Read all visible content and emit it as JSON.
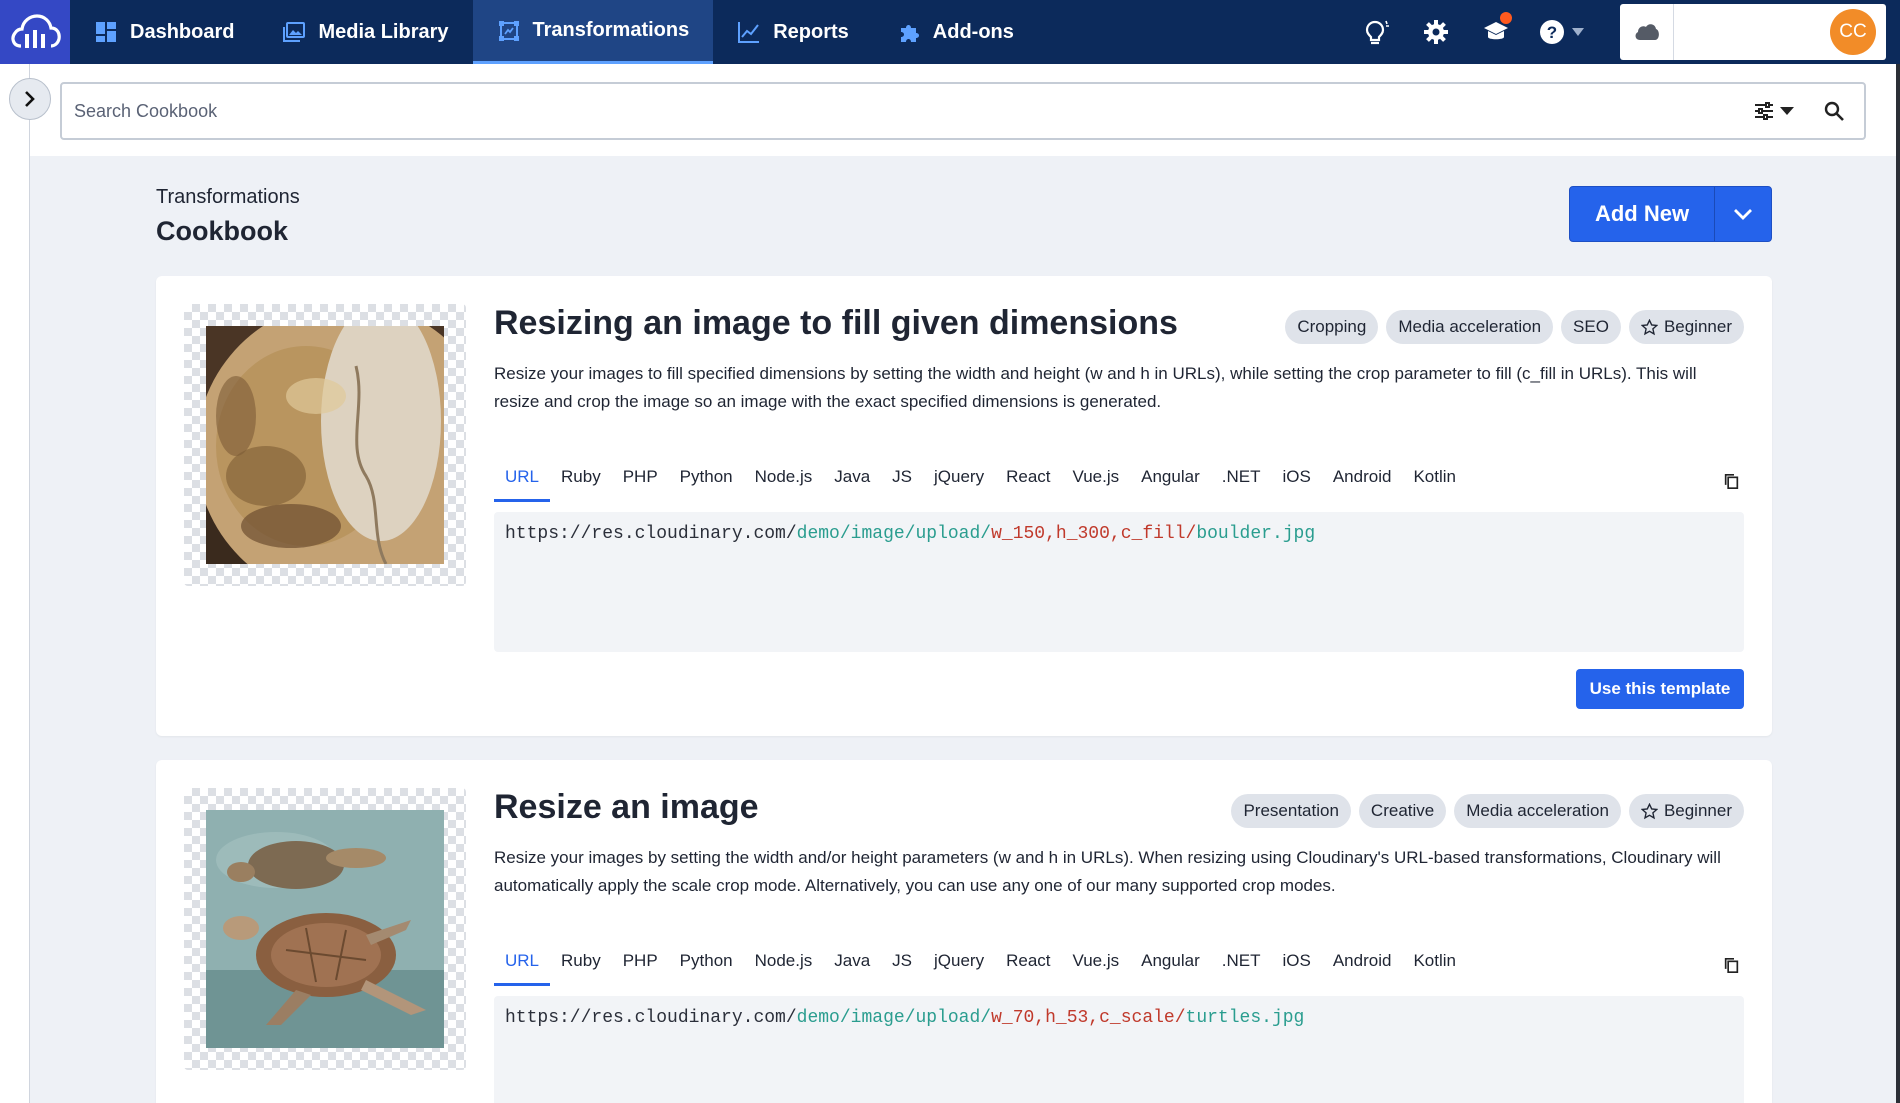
{
  "nav": {
    "items": [
      {
        "label": "Dashboard",
        "icon": "dashboard-icon"
      },
      {
        "label": "Media Library",
        "icon": "media-library-icon"
      },
      {
        "label": "Transformations",
        "icon": "transformations-icon",
        "active": true
      },
      {
        "label": "Reports",
        "icon": "reports-chart-icon"
      },
      {
        "label": "Add-ons",
        "icon": "puzzle-icon"
      }
    ],
    "user_initials": "CC"
  },
  "search": {
    "placeholder": "Search Cookbook"
  },
  "header": {
    "breadcrumb": "Transformations",
    "title": "Cookbook",
    "add_new_label": "Add New"
  },
  "languages": [
    "URL",
    "Ruby",
    "PHP",
    "Python",
    "Node.js",
    "Java",
    "JS",
    "jQuery",
    "React",
    "Vue.js",
    "Angular",
    ".NET",
    "iOS",
    "Android",
    "Kotlin"
  ],
  "cards": [
    {
      "title": "Resizing an image to fill given dimensions",
      "tags": [
        "Cropping",
        "Media acceleration",
        "SEO",
        "Beginner"
      ],
      "description": "Resize your images to fill specified dimensions by setting the width and height (w and h in URLs), while setting the crop parameter to fill (c_fill in URLs). This will resize and crop the image so an image with the exact specified dimensions is generated.",
      "url_base": "https://res.cloudinary.com/",
      "url_path": "demo/image/upload/",
      "url_transform": "w_150,h_300,c_fill/",
      "url_file": "boulder.jpg",
      "button_label": "Use this template"
    },
    {
      "title": "Resize an image",
      "tags": [
        "Presentation",
        "Creative",
        "Media acceleration",
        "Beginner"
      ],
      "description": "Resize your images by setting the width and/or height parameters (w and h in URLs). When resizing using Cloudinary's URL-based transformations, Cloudinary will automatically apply the scale crop mode. Alternatively, you can use any one of our many supported crop modes.",
      "url_base": "https://res.cloudinary.com/",
      "url_path": "demo/image/upload/",
      "url_transform": "w_70,h_53,c_scale/",
      "url_file": "turtles.jpg"
    }
  ],
  "colors": {
    "nav_bg": "#0c2a5b",
    "accent": "#2563eb",
    "url_path": "#2a9d8f",
    "url_transform": "#c0392b"
  }
}
